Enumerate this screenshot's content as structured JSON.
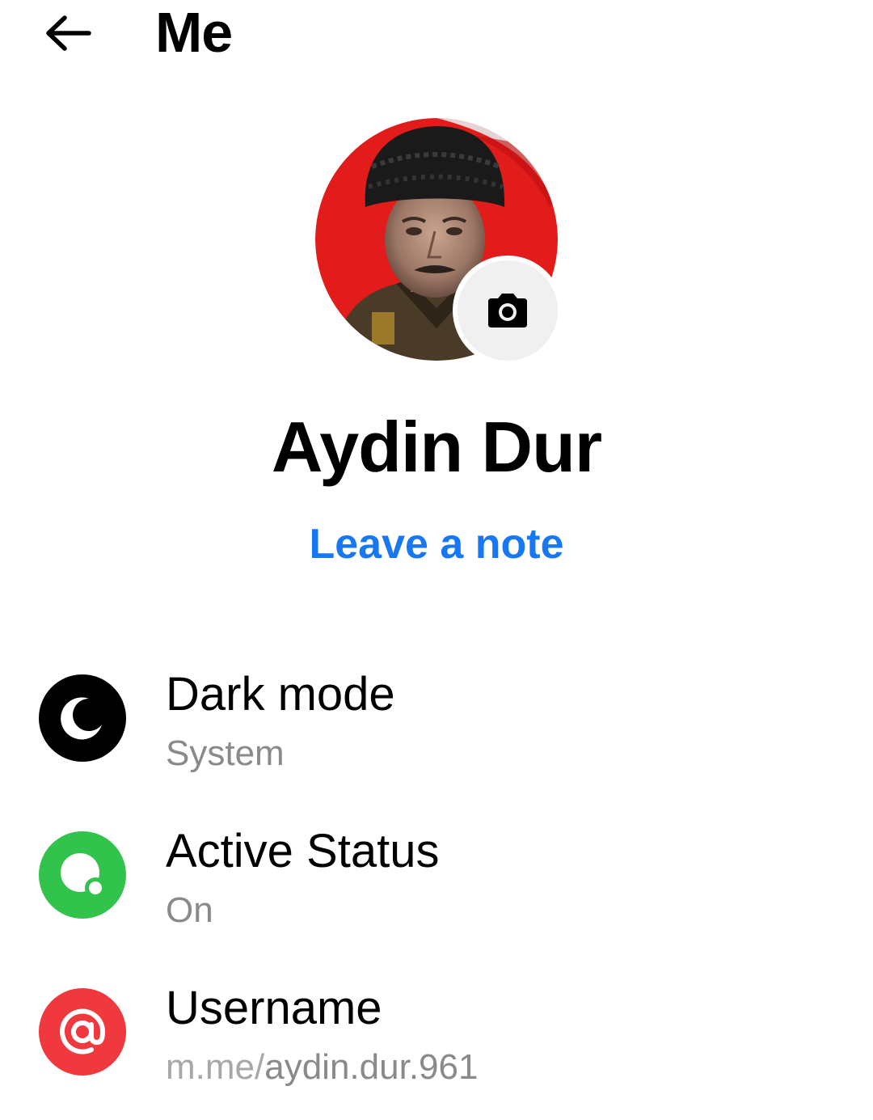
{
  "header": {
    "title": "Me",
    "back_icon": "arrow-left-icon"
  },
  "profile": {
    "name": "Aydin Dur",
    "leave_note_label": "Leave a note",
    "camera_icon": "camera-icon"
  },
  "settings": [
    {
      "title": "Dark mode",
      "subtitle": "System",
      "icon": "moon-icon",
      "icon_color": "#000000"
    },
    {
      "title": "Active Status",
      "subtitle": "On",
      "icon": "active-status-icon",
      "icon_color": "#31c34b"
    },
    {
      "title": "Username",
      "subtitle_prefix": "m.me/",
      "subtitle_main": "aydin.dur.961",
      "icon": "at-sign-icon",
      "icon_color": "#f0393e"
    }
  ],
  "colors": {
    "accent": "#1877f2",
    "secondary_text": "#8a8a8a"
  }
}
